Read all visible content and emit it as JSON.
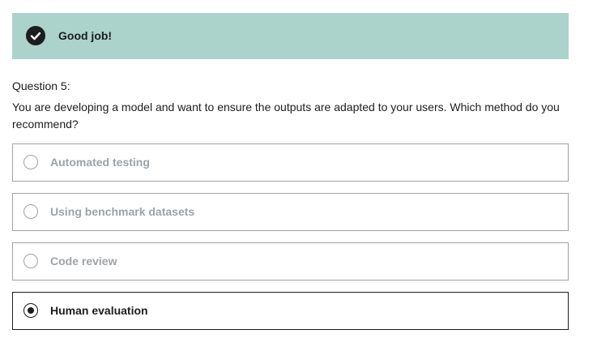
{
  "banner": {
    "text": "Good job!",
    "icon": "check-circle-icon",
    "background": "#acd2cc"
  },
  "question": {
    "number_label": "Question 5:",
    "text": "You are developing a model and want to ensure the outputs are adapted to your users. Which method do you recommend?"
  },
  "options": [
    {
      "label": "Automated testing",
      "selected": false
    },
    {
      "label": "Using benchmark datasets",
      "selected": false
    },
    {
      "label": "Code review",
      "selected": false
    },
    {
      "label": "Human evaluation",
      "selected": true
    }
  ],
  "colors": {
    "text": "#1c1d1f",
    "muted": "#9da3a7",
    "success_bg": "#acd2cc"
  }
}
